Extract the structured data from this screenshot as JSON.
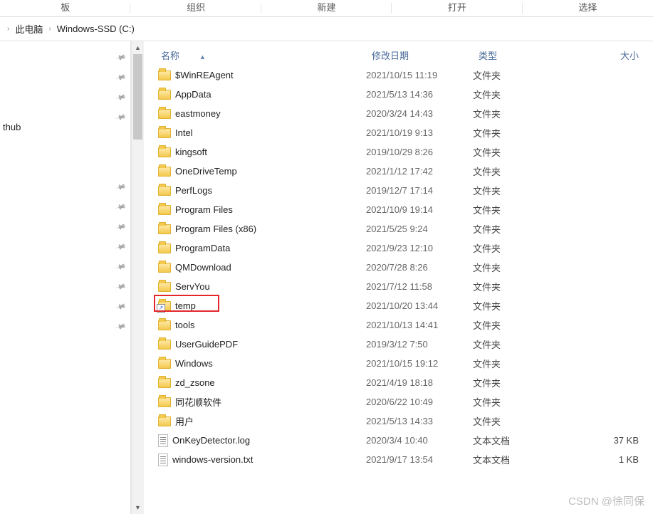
{
  "ribbon": {
    "g1": "板",
    "g2": "组织",
    "g3": "新建",
    "g4": "打开",
    "g5": "选择"
  },
  "crumbs": {
    "root": "此电脑",
    "drive": "Windows-SSD (C:)",
    "chev": "›"
  },
  "nav": {
    "item0": "thub"
  },
  "hdr": {
    "name": "名称",
    "date": "修改日期",
    "type": "类型",
    "size": "大小",
    "sort": "▲"
  },
  "types": {
    "folder": "文件夹",
    "txt": "文本文档"
  },
  "rows": [
    {
      "icon": "folder",
      "name": "$WinREAgent",
      "date": "2021/10/15 11:19",
      "type": "文件夹",
      "size": ""
    },
    {
      "icon": "folder",
      "name": "AppData",
      "date": "2021/5/13 14:36",
      "type": "文件夹",
      "size": ""
    },
    {
      "icon": "folder",
      "name": "eastmoney",
      "date": "2020/3/24 14:43",
      "type": "文件夹",
      "size": ""
    },
    {
      "icon": "folder",
      "name": "Intel",
      "date": "2021/10/19 9:13",
      "type": "文件夹",
      "size": ""
    },
    {
      "icon": "folder",
      "name": "kingsoft",
      "date": "2019/10/29 8:26",
      "type": "文件夹",
      "size": ""
    },
    {
      "icon": "folder",
      "name": "OneDriveTemp",
      "date": "2021/1/12 17:42",
      "type": "文件夹",
      "size": ""
    },
    {
      "icon": "folder",
      "name": "PerfLogs",
      "date": "2019/12/7 17:14",
      "type": "文件夹",
      "size": ""
    },
    {
      "icon": "folder",
      "name": "Program Files",
      "date": "2021/10/9 19:14",
      "type": "文件夹",
      "size": ""
    },
    {
      "icon": "folder",
      "name": "Program Files (x86)",
      "date": "2021/5/25 9:24",
      "type": "文件夹",
      "size": ""
    },
    {
      "icon": "folder",
      "name": "ProgramData",
      "date": "2021/9/23 12:10",
      "type": "文件夹",
      "size": ""
    },
    {
      "icon": "folder",
      "name": "QMDownload",
      "date": "2020/7/28 8:26",
      "type": "文件夹",
      "size": ""
    },
    {
      "icon": "folder",
      "name": "ServYou",
      "date": "2021/7/12 11:58",
      "type": "文件夹",
      "size": ""
    },
    {
      "icon": "shortcut",
      "name": "temp",
      "date": "2021/10/20 13:44",
      "type": "文件夹",
      "size": "",
      "highlight": true
    },
    {
      "icon": "folder",
      "name": "tools",
      "date": "2021/10/13 14:41",
      "type": "文件夹",
      "size": ""
    },
    {
      "icon": "folder",
      "name": "UserGuidePDF",
      "date": "2019/3/12 7:50",
      "type": "文件夹",
      "size": ""
    },
    {
      "icon": "folder",
      "name": "Windows",
      "date": "2021/10/15 19:12",
      "type": "文件夹",
      "size": ""
    },
    {
      "icon": "folder",
      "name": "zd_zsone",
      "date": "2021/4/19 18:18",
      "type": "文件夹",
      "size": ""
    },
    {
      "icon": "folder",
      "name": "同花顺软件",
      "date": "2020/6/22 10:49",
      "type": "文件夹",
      "size": ""
    },
    {
      "icon": "folder",
      "name": "用户",
      "date": "2021/5/13 14:33",
      "type": "文件夹",
      "size": ""
    },
    {
      "icon": "file",
      "name": "OnKeyDetector.log",
      "date": "2020/3/4 10:40",
      "type": "文本文档",
      "size": "37 KB"
    },
    {
      "icon": "file",
      "name": "windows-version.txt",
      "date": "2021/9/17 13:54",
      "type": "文本文档",
      "size": "1 KB"
    }
  ],
  "pins": [
    72,
    100,
    128,
    156,
    254,
    282,
    310,
    338,
    366,
    394,
    422,
    450
  ],
  "watermark": "CSDN @徐同保"
}
